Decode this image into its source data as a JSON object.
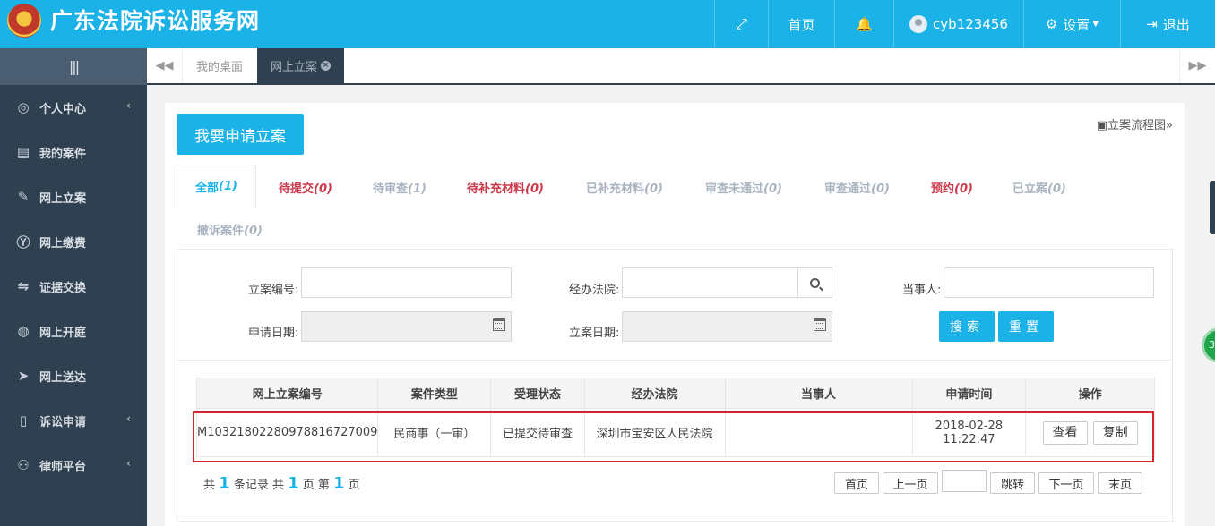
{
  "header": {
    "site_title": "广东法院诉讼服务网",
    "nav": {
      "home": "首页",
      "username": "cyb123456",
      "settings": "设置",
      "logout": "退出"
    }
  },
  "sidebar": {
    "toggle": "|||",
    "items": [
      {
        "label": "个人中心",
        "icon": "user-circle-icon",
        "has_arrow": true
      },
      {
        "label": "我的案件",
        "icon": "document-icon",
        "has_arrow": false
      },
      {
        "label": "网上立案",
        "icon": "edit-icon",
        "has_arrow": false
      },
      {
        "label": "网上缴费",
        "icon": "yen-icon",
        "has_arrow": false
      },
      {
        "label": "证据交换",
        "icon": "exchange-icon",
        "has_arrow": false
      },
      {
        "label": "网上开庭",
        "icon": "globe-icon",
        "has_arrow": false
      },
      {
        "label": "网上送达",
        "icon": "send-icon",
        "has_arrow": false
      },
      {
        "label": "诉讼申请",
        "icon": "file-icon",
        "has_arrow": true
      },
      {
        "label": "律师平台",
        "icon": "person-icon",
        "has_arrow": true
      }
    ]
  },
  "tabs": {
    "desktop": "我的桌面",
    "online_filing": "网上立案"
  },
  "main": {
    "apply_button": "我要申请立案",
    "flow_chart_link": "立案流程图",
    "status_tabs": [
      {
        "label": "全部",
        "count": "(1)"
      },
      {
        "label": "待提交",
        "count": "(0)"
      },
      {
        "label": "待审查",
        "count": "(1)"
      },
      {
        "label": "待补充材料",
        "count": "(0)"
      },
      {
        "label": "已补充材料",
        "count": "(0)"
      },
      {
        "label": "审查未通过",
        "count": "(0)"
      },
      {
        "label": "审查通过",
        "count": "(0)"
      },
      {
        "label": "预约",
        "count": "(0)"
      },
      {
        "label": "已立案",
        "count": "(0)"
      },
      {
        "label": "撤诉案件",
        "count": "(0)"
      }
    ],
    "search": {
      "case_no_label": "立案编号:",
      "court_label": "经办法院:",
      "party_label": "当事人:",
      "apply_date_label": "申请日期:",
      "filing_date_label": "立案日期:",
      "search_button": "搜索",
      "reset_button": "重置"
    },
    "table": {
      "headers": [
        "网上立案编号",
        "案件类型",
        "受理状态",
        "经办法院",
        "当事人",
        "申请时间",
        "操作"
      ],
      "rows": [
        {
          "case_no": "M10321802280978816727009",
          "case_type": "民商事（一审）",
          "status": "已提交待审查",
          "court": "深圳市宝安区人民法院",
          "party": "",
          "apply_date": "2018-02-28",
          "apply_time": "11:22:47",
          "view": "查看",
          "copy": "复制"
        }
      ]
    },
    "pagination": {
      "total_prefix": "共",
      "total_records": "1",
      "records_suffix": "条记录 共",
      "total_pages": "1",
      "pages_suffix": "页 第",
      "current_page": "1",
      "current_suffix": "页",
      "first": "首页",
      "prev": "上一页",
      "jump": "跳转",
      "next": "下一页",
      "last": "末页"
    }
  },
  "float_widget": "3"
}
